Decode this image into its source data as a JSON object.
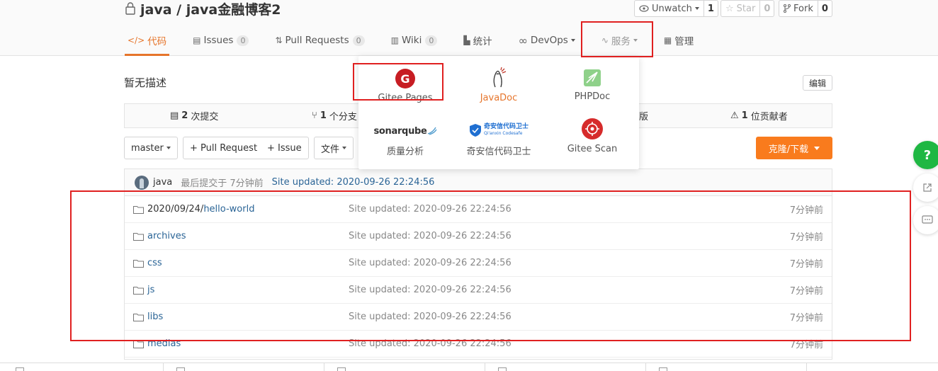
{
  "repo": {
    "title": "java / java金融博客2",
    "watch": {
      "label": "Unwatch",
      "count": "1"
    },
    "star": {
      "label": "Star",
      "count": "0"
    },
    "fork": {
      "label": "Fork",
      "count": "0"
    }
  },
  "tabs": [
    {
      "label": "代码",
      "icon": "code-icon"
    },
    {
      "label": "Issues",
      "badge": "0",
      "icon": "issues-icon"
    },
    {
      "label": "Pull Requests",
      "badge": "0",
      "icon": "pull-request-icon"
    },
    {
      "label": "Wiki",
      "badge": "0",
      "icon": "wiki-icon"
    },
    {
      "label": "统计",
      "icon": "chart-icon"
    },
    {
      "label": "DevOps",
      "icon": "infinity-icon"
    },
    {
      "label": "服务",
      "icon": "pulse-icon"
    },
    {
      "label": "管理",
      "icon": "settings-doc-icon"
    }
  ],
  "description": "暂无描述",
  "edit_label": "编辑",
  "stats": {
    "commits_count": "2",
    "commits_label": "次提交",
    "branches_count": "1",
    "branches_label": "个分支",
    "releases_label": "版",
    "contributors_count": "1",
    "contributors_label": "位贡献者"
  },
  "toolbar": {
    "branch": "master",
    "pull_request": "+ Pull Request",
    "issue": "+ Issue",
    "file": "文件",
    "clone": "克隆/下载"
  },
  "services_menu": [
    {
      "label": "Gitee Pages",
      "icon": "gitee-pages-icon"
    },
    {
      "label": "JavaDoc",
      "icon": "javadoc-icon"
    },
    {
      "label": "PHPDoc",
      "icon": "phpdoc-icon"
    },
    {
      "label": "质量分析",
      "icon": "sonarqube-icon",
      "brand": "sonarqube"
    },
    {
      "label": "奇安信代码卫士",
      "icon": "qianxin-icon",
      "brand": "奇安信代码卫士",
      "brand_sub": "Qi'anxin Codesafe"
    },
    {
      "label": "Gitee Scan",
      "icon": "gitee-scan-icon"
    }
  ],
  "last_commit": {
    "author": "java",
    "info": "最后提交于 7分钟前",
    "message": "Site updated: 2020-09-26 22:24:56"
  },
  "files": [
    {
      "prefix": "2020/09/24/",
      "name": "hello-world",
      "message": "Site updated: 2020-09-26 22:24:56",
      "time": "7分钟前"
    },
    {
      "prefix": "",
      "name": "archives",
      "message": "Site updated: 2020-09-26 22:24:56",
      "time": "7分钟前"
    },
    {
      "prefix": "",
      "name": "css",
      "message": "Site updated: 2020-09-26 22:24:56",
      "time": "7分钟前"
    },
    {
      "prefix": "",
      "name": "js",
      "message": "Site updated: 2020-09-26 22:24:56",
      "time": "7分钟前"
    },
    {
      "prefix": "",
      "name": "libs",
      "message": "Site updated: 2020-09-26 22:24:56",
      "time": "7分钟前"
    },
    {
      "prefix": "",
      "name": "medias",
      "message": "Site updated: 2020-09-26 22:24:56",
      "time": "7分钟前"
    }
  ],
  "float_buttons": {
    "help": "?"
  },
  "colors": {
    "accent": "#e6752b",
    "clone_button": "#f97b1d",
    "annotation_red": "#e02020",
    "link_blue": "#2a6496",
    "help_green": "#1fb743"
  }
}
